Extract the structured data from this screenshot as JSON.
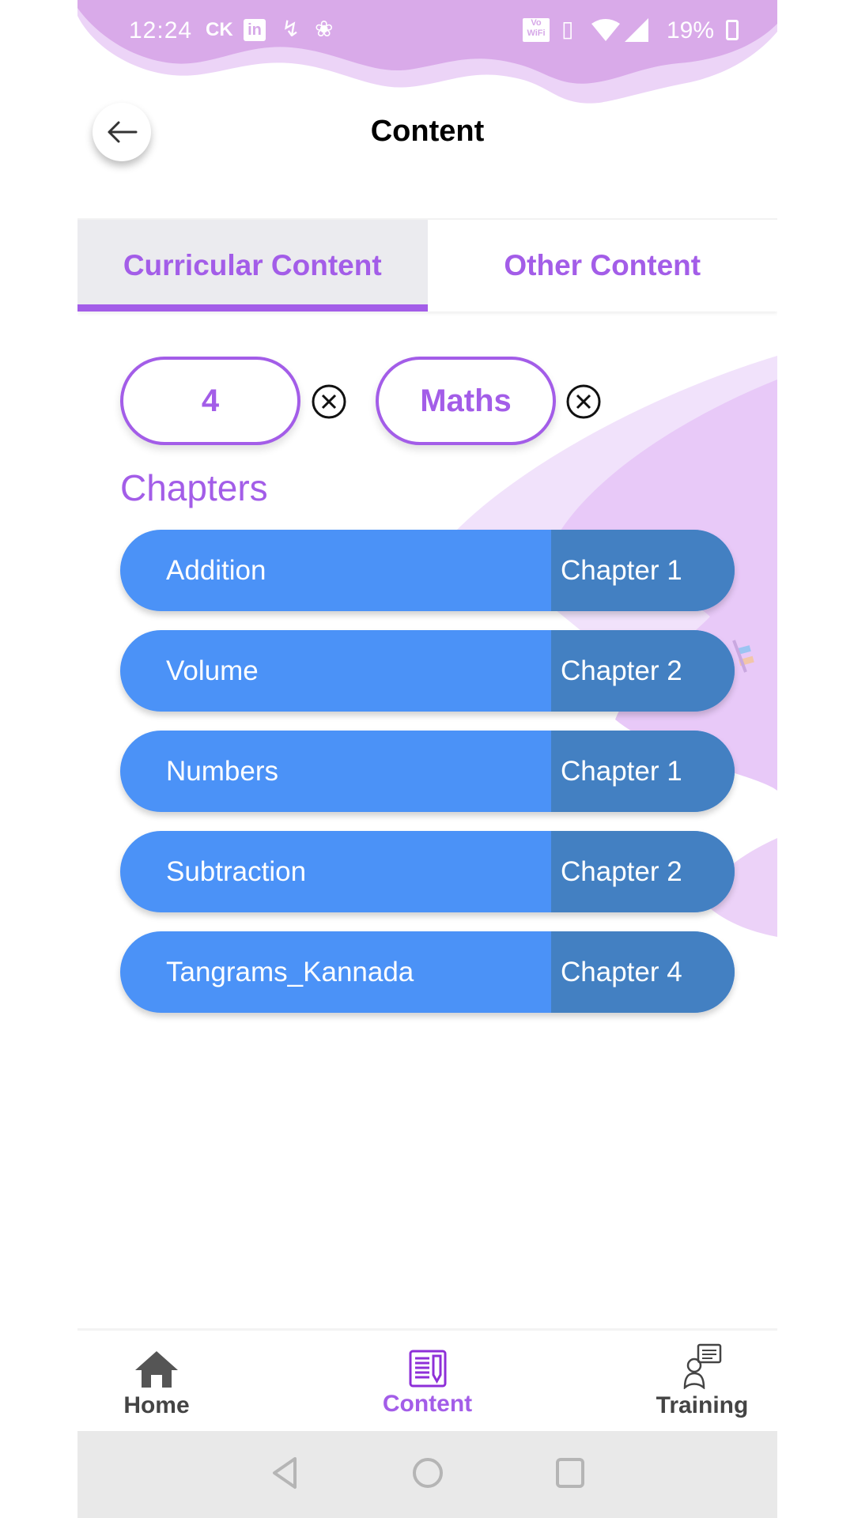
{
  "status_bar": {
    "time": "12:24",
    "carrier_badge": "CK",
    "notification_icons": [
      "linkedin-icon",
      "phone-missed-icon",
      "airtel-icon"
    ],
    "volte_label": "Vo WiFi",
    "system_icons": [
      "vibrate-icon",
      "wifi-icon",
      "signal-icon",
      "battery-icon"
    ],
    "battery_percent": "19%"
  },
  "header": {
    "title": "Content",
    "back_icon": "arrow-left-icon"
  },
  "tabs": [
    {
      "label": "Curricular Content",
      "active": true
    },
    {
      "label": "Other Content",
      "active": false
    }
  ],
  "filters": [
    {
      "value": "4",
      "clear_icon": "circle-x-icon"
    },
    {
      "value": "Maths",
      "clear_icon": "circle-x-icon"
    }
  ],
  "chapters_section": {
    "title": "Chapters",
    "items": [
      {
        "name": "Addition",
        "chapter": "Chapter 1"
      },
      {
        "name": "Volume",
        "chapter": "Chapter 2"
      },
      {
        "name": "Numbers",
        "chapter": "Chapter 1"
      },
      {
        "name": "Subtraction",
        "chapter": "Chapter 2"
      },
      {
        "name": "Tangrams_Kannada",
        "chapter": "Chapter 4"
      }
    ]
  },
  "bottom_nav": [
    {
      "label": "Home",
      "icon": "home-icon",
      "active": false
    },
    {
      "label": "Content",
      "icon": "content-icon",
      "active": true
    },
    {
      "label": "Training",
      "icon": "training-icon",
      "active": false
    }
  ],
  "system_nav": [
    "back-triangle-icon",
    "home-circle-icon",
    "recents-square-icon"
  ],
  "colors": {
    "accent": "#a35de8",
    "row_blue": "#4b92f7",
    "row_chapter_blue": "#4380c2",
    "header_wave": "#d9aae9"
  }
}
